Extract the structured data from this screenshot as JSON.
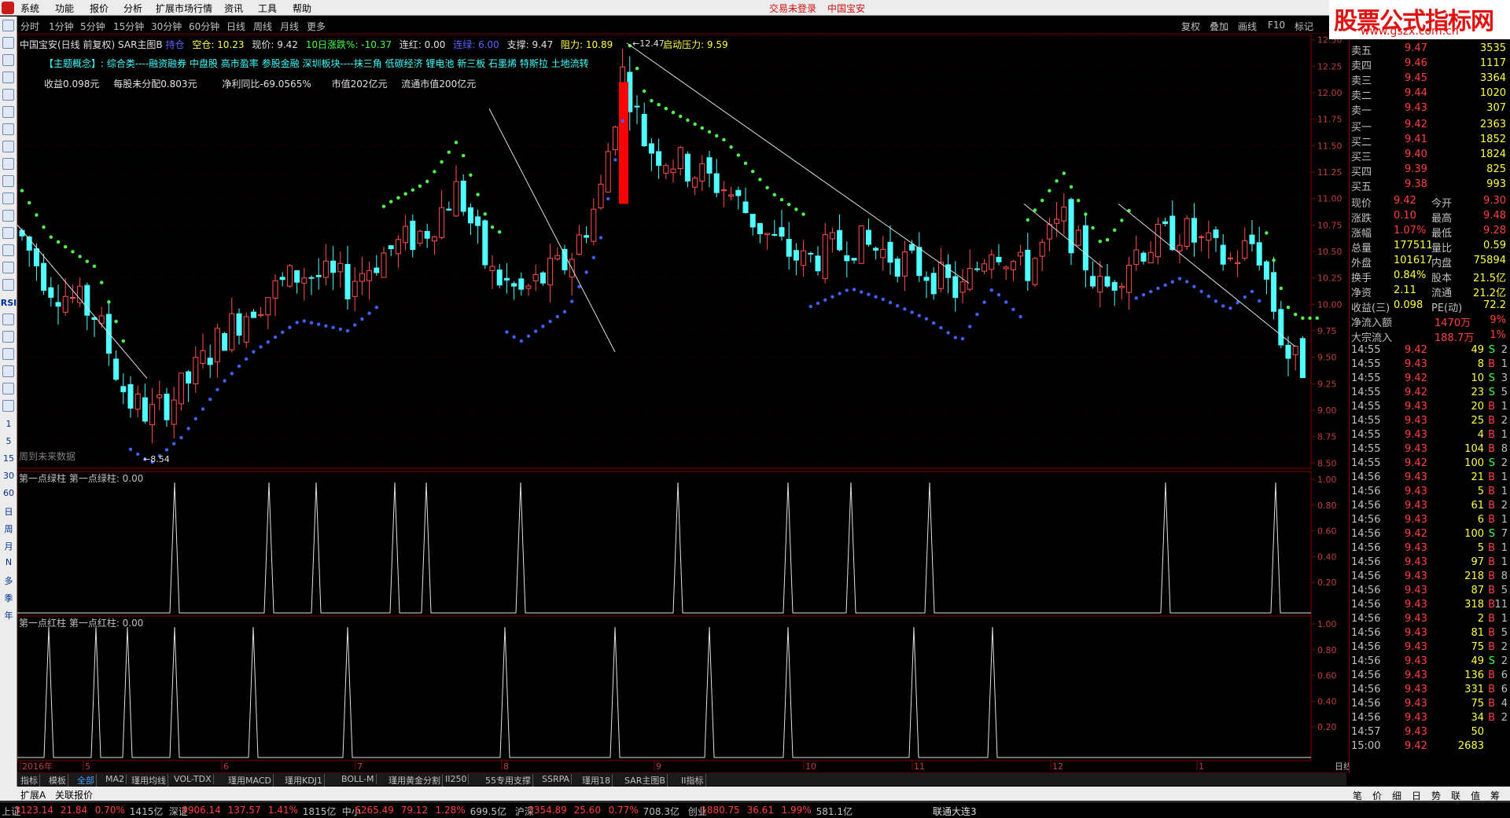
{
  "menu": {
    "items": [
      "系统",
      "功能",
      "报价",
      "分析",
      "扩展市场行情",
      "资讯",
      "工具",
      "帮助"
    ],
    "login_notice": "交易未登录",
    "stock_name": "中国宝安"
  },
  "watermark": {
    "title": "股票公式指标网",
    "url": "www.gszx.com.cn"
  },
  "periods": [
    "分时",
    "1分钟",
    "5分钟",
    "15分钟",
    "30分钟",
    "60分钟",
    "日线",
    "周线",
    "月线",
    "更多"
  ],
  "tools_right": [
    "复权",
    "叠加",
    "画线",
    "F10",
    "标记"
  ],
  "lefttool": {
    "labels": [
      "1",
      "5",
      "15",
      "30",
      "60",
      "日",
      "周",
      "月",
      "N",
      "多",
      "季",
      "年"
    ],
    "rsi": "RSI"
  },
  "info": {
    "line1": {
      "name": "中国宝安(日线 前复权)",
      "indicator": "SAR主图B",
      "ind2": "持仓",
      "space": "空仓: 10.23",
      "price": "现价: 9.42",
      "drop10": "10日涨跌%: -10.37",
      "lianhong": "连红: 0.00",
      "liangreen": "连绿: 6.00",
      "support": "支撑: 9.47",
      "resistance": "阻力: 10.89",
      "launch": "启动压力: 9.59"
    },
    "line2": "【主题概念】: 综合类----融资融券 中盘股 高市盈率 参股金融 深圳板块----抹三角 低碳经济 锂电池 新三板 石墨烯 特斯拉 土地流转",
    "line3": {
      "eps": "收益0.098元",
      "undist": "每股未分配0.803元",
      "profit": "净利同比-69.0565%",
      "mcap": "市值202亿元",
      "float": "流通市值200亿元"
    }
  },
  "chart_data": {
    "type": "candlestick",
    "yticks": [
      "12.50",
      "12.25",
      "12.00",
      "11.75",
      "11.50",
      "11.25",
      "11.00",
      "10.75",
      "10.50",
      "10.25",
      "10.00",
      "9.75",
      "9.50",
      "9.25",
      "9.00",
      "8.75",
      "8.50"
    ],
    "ylim": [
      8.45,
      12.55
    ],
    "months": [
      "2016年",
      "5",
      "6",
      "7",
      "8",
      "9",
      "10",
      "11",
      "12",
      "1"
    ],
    "high_label": "12.47",
    "low_label": "8.54",
    "future_label": "周到未来数据",
    "period_label": "日线",
    "panel2": {
      "title": "第一点绿柱 第一点绿柱: 0.00",
      "yticks": [
        "1.00",
        "0.80",
        "0.60",
        "0.40",
        "0.20"
      ],
      "peaks": [
        10,
        16,
        19,
        24,
        26,
        32,
        42,
        49,
        53,
        58,
        73,
        80
      ]
    },
    "panel3": {
      "title": "第一点红柱 第一点红柱: 0.00",
      "yticks": [
        "1.00",
        "0.80",
        "0.60",
        "0.40",
        "0.20"
      ],
      "peaks": [
        2,
        5,
        7,
        10,
        15,
        21,
        31,
        38,
        44,
        49,
        57,
        62
      ]
    }
  },
  "quote": {
    "sell": [
      {
        "label": "卖五",
        "price": "9.47",
        "vol": "3535"
      },
      {
        "label": "卖四",
        "price": "9.46",
        "vol": "1117"
      },
      {
        "label": "卖三",
        "price": "9.45",
        "vol": "3364"
      },
      {
        "label": "卖二",
        "price": "9.44",
        "vol": "1020"
      },
      {
        "label": "卖一",
        "price": "9.43",
        "vol": "307"
      }
    ],
    "buy": [
      {
        "label": "买一",
        "price": "9.42",
        "vol": "2363"
      },
      {
        "label": "买二",
        "price": "9.41",
        "vol": "1852"
      },
      {
        "label": "买三",
        "price": "9.40",
        "vol": "1824"
      },
      {
        "label": "买四",
        "price": "9.39",
        "vol": "825"
      },
      {
        "label": "买五",
        "price": "9.38",
        "vol": "993"
      }
    ],
    "stats": [
      {
        "l1": "现价",
        "v1": "9.42",
        "l2": "今开",
        "v2": "9.30"
      },
      {
        "l1": "涨跌",
        "v1": "0.10",
        "l2": "最高",
        "v2": "9.48"
      },
      {
        "l1": "涨幅",
        "v1": "1.07%",
        "l2": "最低",
        "v2": "9.28"
      },
      {
        "l1": "总量",
        "v1": "177511",
        "l2": "量比",
        "v2": "0.59"
      },
      {
        "l1": "外盘",
        "v1": "101617",
        "l2": "内盘",
        "v2": "75894"
      },
      {
        "l1": "换手",
        "v1": "0.84%",
        "l2": "股本",
        "v2": "21.5亿"
      },
      {
        "l1": "净资",
        "v1": "2.11",
        "l2": "流通",
        "v2": "21.2亿"
      },
      {
        "l1": "收益(三)",
        "v1": "0.098",
        "l2": "PE(动)",
        "v2": "72.2"
      }
    ],
    "flow": [
      {
        "label": "净流入额",
        "v": "1470万",
        "p": "9%"
      },
      {
        "label": "大宗流入",
        "v": "188.7万",
        "p": "1%"
      }
    ],
    "ticks": [
      [
        "14:55",
        "9.42",
        "49",
        "S",
        "2"
      ],
      [
        "14:55",
        "9.43",
        "8",
        "B",
        "1"
      ],
      [
        "14:55",
        "9.42",
        "10",
        "S",
        "3"
      ],
      [
        "14:55",
        "9.42",
        "23",
        "S",
        "5"
      ],
      [
        "14:55",
        "9.43",
        "20",
        "B",
        "1"
      ],
      [
        "14:55",
        "9.43",
        "25",
        "B",
        "2"
      ],
      [
        "14:55",
        "9.43",
        "4",
        "B",
        "1"
      ],
      [
        "14:55",
        "9.43",
        "104",
        "B",
        "8"
      ],
      [
        "14:55",
        "9.42",
        "100",
        "S",
        "2"
      ],
      [
        "14:56",
        "9.43",
        "21",
        "B",
        "1"
      ],
      [
        "14:56",
        "9.43",
        "5",
        "B",
        "1"
      ],
      [
        "14:56",
        "9.43",
        "61",
        "B",
        "2"
      ],
      [
        "14:56",
        "9.43",
        "6",
        "B",
        "1"
      ],
      [
        "14:56",
        "9.42",
        "100",
        "S",
        "7"
      ],
      [
        "14:56",
        "9.43",
        "5",
        "B",
        "1"
      ],
      [
        "14:56",
        "9.43",
        "97",
        "B",
        "1"
      ],
      [
        "14:56",
        "9.43",
        "218",
        "B",
        "8"
      ],
      [
        "14:56",
        "9.43",
        "87",
        "B",
        "5"
      ],
      [
        "14:56",
        "9.43",
        "318",
        "B",
        "11"
      ],
      [
        "14:56",
        "9.43",
        "2",
        "B",
        "1"
      ],
      [
        "14:56",
        "9.43",
        "81",
        "B",
        "5"
      ],
      [
        "14:56",
        "9.43",
        "75",
        "B",
        "2"
      ],
      [
        "14:56",
        "9.43",
        "49",
        "S",
        "2"
      ],
      [
        "14:56",
        "9.43",
        "136",
        "B",
        "6"
      ],
      [
        "14:56",
        "9.43",
        "331",
        "B",
        "6"
      ],
      [
        "14:56",
        "9.43",
        "75",
        "B",
        "4"
      ],
      [
        "14:56",
        "9.43",
        "34",
        "B",
        "2"
      ],
      [
        "14:57",
        "9.43",
        "50",
        "",
        ""
      ],
      [
        "15:00",
        "9.42",
        "2683",
        "",
        ""
      ]
    ],
    "bottom_tabs": [
      "笔",
      "价",
      "细",
      "日",
      "势",
      "联",
      "值",
      "筹"
    ]
  },
  "tabs": [
    "指标",
    "模板",
    "全部",
    "MA2",
    "瑾用均线",
    "VOL-TDX",
    "瑾用MACD",
    "瑾用KDJ1",
    "BOLL-M",
    "瑾用黄金分割",
    "II250",
    "55专用支撑",
    "SSRPA",
    "瑾用18",
    "SAR主图B",
    "II指标"
  ],
  "bottombar": [
    "扩展A",
    "关联报价"
  ],
  "indexes": [
    {
      "name": "上证",
      "val": "3123.14",
      "chg": "21.84",
      "pct": "0.70%",
      "amt": "1415亿"
    },
    {
      "name": "深证",
      "val": "9906.14",
      "chg": "137.57",
      "pct": "1.41%",
      "amt": "1815亿"
    },
    {
      "name": "中小",
      "val": "6265.49",
      "chg": "79.12",
      "pct": "1.28%",
      "amt": "699.5亿"
    },
    {
      "name": "沪深",
      "val": "3354.89",
      "chg": "25.60",
      "pct": "0.77%",
      "amt": "708.3亿"
    },
    {
      "name": "创业",
      "val": "1880.75",
      "chg": "36.61",
      "pct": "1.99%",
      "amt": "581.1亿"
    }
  ],
  "server": "联通大连3"
}
